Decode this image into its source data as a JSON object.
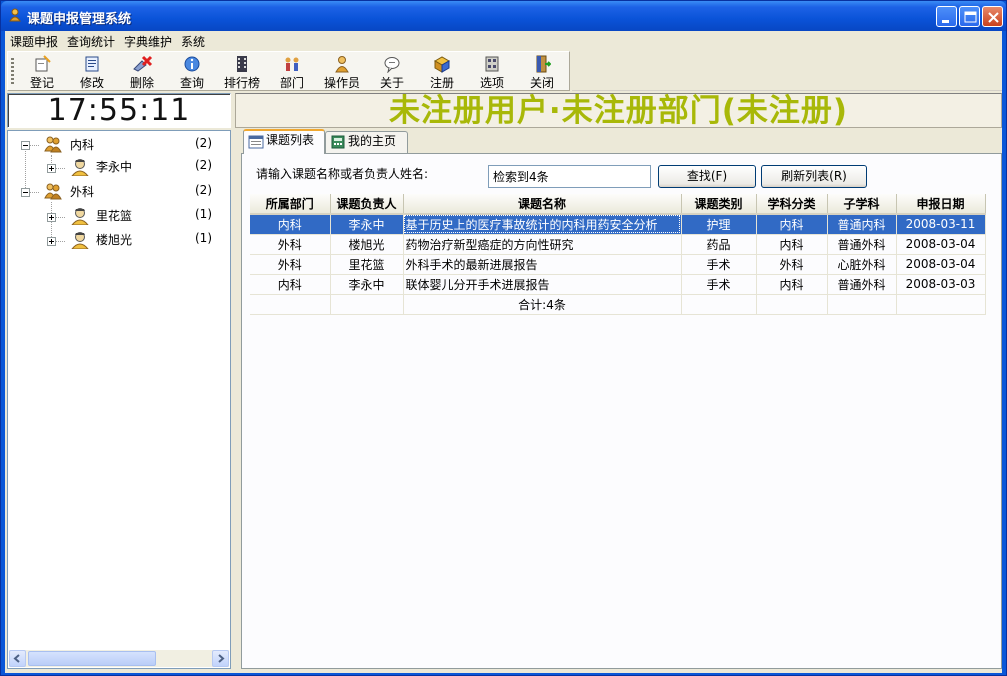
{
  "window": {
    "title": "课题申报管理系统"
  },
  "menu": [
    "课题申报",
    "查询统计",
    "字典维护",
    "系统"
  ],
  "toolbar": {
    "buttons": [
      {
        "label": "登记",
        "icon": "register-icon"
      },
      {
        "label": "修改",
        "icon": "edit-icon"
      },
      {
        "label": "删除",
        "icon": "delete-icon"
      },
      {
        "label": "查询",
        "icon": "info-icon"
      },
      {
        "label": "排行榜",
        "icon": "film-icon"
      },
      {
        "label": "部门",
        "icon": "department-icon"
      },
      {
        "label": "操作员",
        "icon": "operator-icon"
      },
      {
        "label": "关于",
        "icon": "speech-bubble-icon"
      },
      {
        "label": "注册",
        "icon": "register-box-icon"
      },
      {
        "label": "选项",
        "icon": "options-icon"
      },
      {
        "label": "关闭",
        "icon": "exit-door-icon"
      }
    ]
  },
  "clock": "17:55:11",
  "banner": "未注册用户·未注册部门(未注册)",
  "tree": {
    "nodes": [
      {
        "label": "内科",
        "count": "(2)",
        "children": [
          {
            "label": "李永中",
            "count": "(2)"
          }
        ]
      },
      {
        "label": "外科",
        "count": "(2)",
        "children": [
          {
            "label": "里花篮",
            "count": "(1)"
          },
          {
            "label": "楼旭光",
            "count": "(1)"
          }
        ]
      }
    ]
  },
  "tabs": [
    "课题列表",
    "我的主页"
  ],
  "search": {
    "label": "请输入课题名称或者负责人姓名:",
    "value": "检索到4条",
    "find_button": "查找(F)",
    "refresh_button": "刷新列表(R)"
  },
  "grid": {
    "columns": [
      "所属部门",
      "课题负责人",
      "课题名称",
      "课题类别",
      "学科分类",
      "子学科",
      "申报日期"
    ],
    "rows": [
      [
        "内科",
        "李永中",
        "基于历史上的医疗事故统计的内科用药安全分析",
        "护理",
        "内科",
        "普通内科",
        "2008-03-11"
      ],
      [
        "外科",
        "楼旭光",
        "药物治疗新型癌症的方向性研究",
        "药品",
        "内科",
        "普通外科",
        "2008-03-04"
      ],
      [
        "外科",
        "里花篮",
        "外科手术的最新进展报告",
        "手术",
        "外科",
        "心脏外科",
        "2008-03-04"
      ],
      [
        "内科",
        "李永中",
        "联体婴儿分开手术进展报告",
        "手术",
        "内科",
        "普通外科",
        "2008-03-03"
      ]
    ],
    "total": "合计:4条",
    "selected_row": 0
  }
}
